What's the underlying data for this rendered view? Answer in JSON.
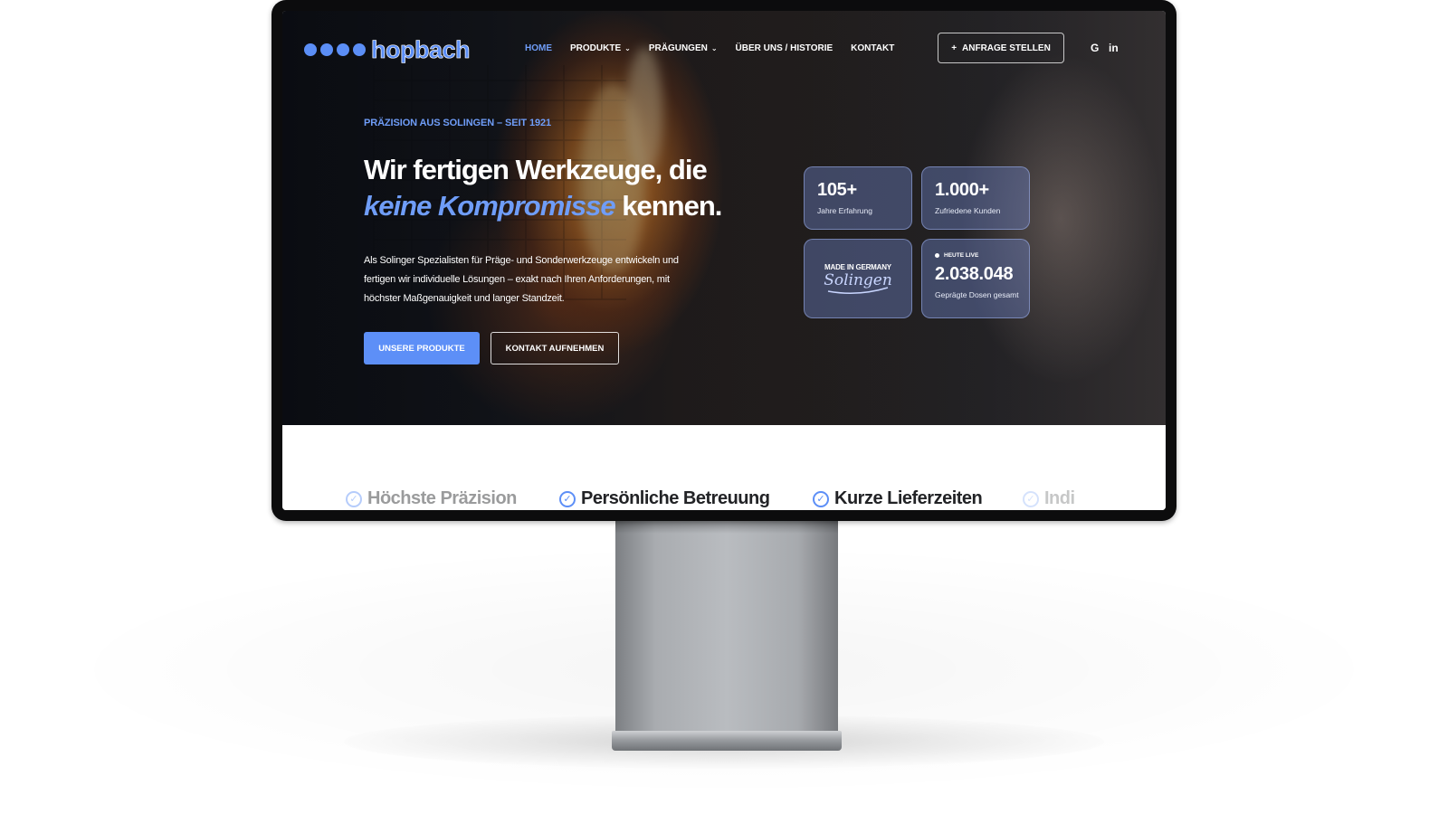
{
  "logo": {
    "dots": 4,
    "wordmark": "hopbach",
    "color": "#5b8ef6"
  },
  "nav": {
    "items": [
      {
        "label": "HOME",
        "active": true,
        "dropdown": false
      },
      {
        "label": "PRODUKTE",
        "active": false,
        "dropdown": true
      },
      {
        "label": "PRÄGUNGEN",
        "active": false,
        "dropdown": true
      },
      {
        "label": "ÜBER UNS / HISTORIE",
        "active": false,
        "dropdown": false
      },
      {
        "label": "KONTAKT",
        "active": false,
        "dropdown": false
      }
    ],
    "cta_label": "ANFRAGE STELLEN",
    "cta_icon": "plus-icon",
    "social": [
      {
        "icon": "google-icon",
        "glyph": "G"
      },
      {
        "icon": "linkedin-icon",
        "glyph": "in"
      }
    ]
  },
  "hero": {
    "eyebrow": "PRÄZISION AUS SOLINGEN – SEIT 1921",
    "headline_line1": "Wir fertigen Werkzeuge, die",
    "headline_accent": "keine Kompromisse",
    "headline_end": " kennen.",
    "lead": "Als Solinger Spezialisten für Präge- und Sonderwerkzeuge entwickeln und fertigen wir individuelle Lösungen – exakt nach Ihren Anforderungen, mit höchster Maßgenauigkeit und langer Standzeit.",
    "primary_button": "UNSERE PRODUKTE",
    "secondary_button": "KONTAKT AUFNEHMEN"
  },
  "stats": {
    "years": {
      "value": "105+",
      "label": "Jahre Erfahrung"
    },
    "customers": {
      "value": "1.000+",
      "label": "Zufriedene Kunden"
    },
    "badge": {
      "top": "MADE IN GERMANY",
      "name": "Solingen"
    },
    "live": {
      "tag": "HEUTE LIVE",
      "value": "2.038.048",
      "label": "Geprägte Dosen gesamt"
    }
  },
  "features": [
    {
      "label": "Höchste Präzision"
    },
    {
      "label": "Persönliche Betreuung"
    },
    {
      "label": "Kurze Lieferzeiten"
    },
    {
      "label": "Indi"
    }
  ],
  "colors": {
    "accent": "#5d8ff7",
    "accent_text": "#6f9df8",
    "bezel": "#0c0c0d",
    "stand": "#a9acb0"
  }
}
